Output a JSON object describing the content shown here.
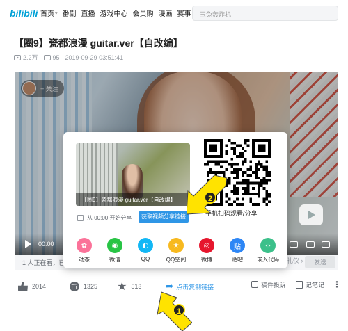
{
  "nav": {
    "logo_text": "bilibili",
    "items": [
      {
        "label": "首页",
        "has_chevron": true
      },
      {
        "label": "番剧",
        "has_chevron": false
      },
      {
        "label": "直播",
        "has_chevron": false
      },
      {
        "label": "游戏中心",
        "has_chevron": false
      },
      {
        "label": "会员购",
        "has_chevron": false
      },
      {
        "label": "漫画",
        "has_chevron": false
      },
      {
        "label": "赛事",
        "has_chevron": false
      }
    ],
    "search_placeholder": "玉兔轰炸机"
  },
  "video": {
    "title": "【圈9】瓷都浪漫 guitar.ver【自改编】",
    "views": "2.2万",
    "danmaku": "95",
    "published": "2019-09-29 03:51:41",
    "follow_label": "+ 关注",
    "current_time": "00:00"
  },
  "danmu_bar": {
    "watching": "1 人正在看，已装",
    "etiquette": "礼仪 ›",
    "send": "发送"
  },
  "actions": {
    "like_count": "2014",
    "coin_count": "1325",
    "fav_count": "513",
    "share_label": "点击复制链接",
    "report_label": "稿件投诉",
    "notes_label": "记笔记",
    "more": "⋮"
  },
  "share_popup": {
    "thumb_caption": "【圈9】瓷都浪漫 guitar.ver【自改编】",
    "start_at_label": "从 00:00 开始分享",
    "get_link_label": "获取视频分享链接",
    "qr_caption": "手机扫码观看/分享",
    "targets": [
      {
        "label": "动态",
        "color": "#fb7299",
        "glyph": "✿",
        "icon": "dynamic-icon"
      },
      {
        "label": "微信",
        "color": "#28c445",
        "glyph": "◉",
        "icon": "wechat-icon"
      },
      {
        "label": "QQ",
        "color": "#12b7f5",
        "glyph": "◐",
        "icon": "qq-icon"
      },
      {
        "label": "QQ空间",
        "color": "#f7b91f",
        "glyph": "★",
        "icon": "qzone-icon"
      },
      {
        "label": "微博",
        "color": "#e6162d",
        "glyph": "◎",
        "icon": "weibo-icon"
      },
      {
        "label": "贴吧",
        "color": "#2d86f5",
        "glyph": "贴",
        "icon": "tieba-icon"
      },
      {
        "label": "嵌入代码",
        "color": "#3cc08a",
        "glyph": "‹›",
        "icon": "embed-code-icon"
      }
    ]
  },
  "annotations": {
    "step1": "1",
    "step2": "2",
    "arrow_color": "#ffe300"
  }
}
